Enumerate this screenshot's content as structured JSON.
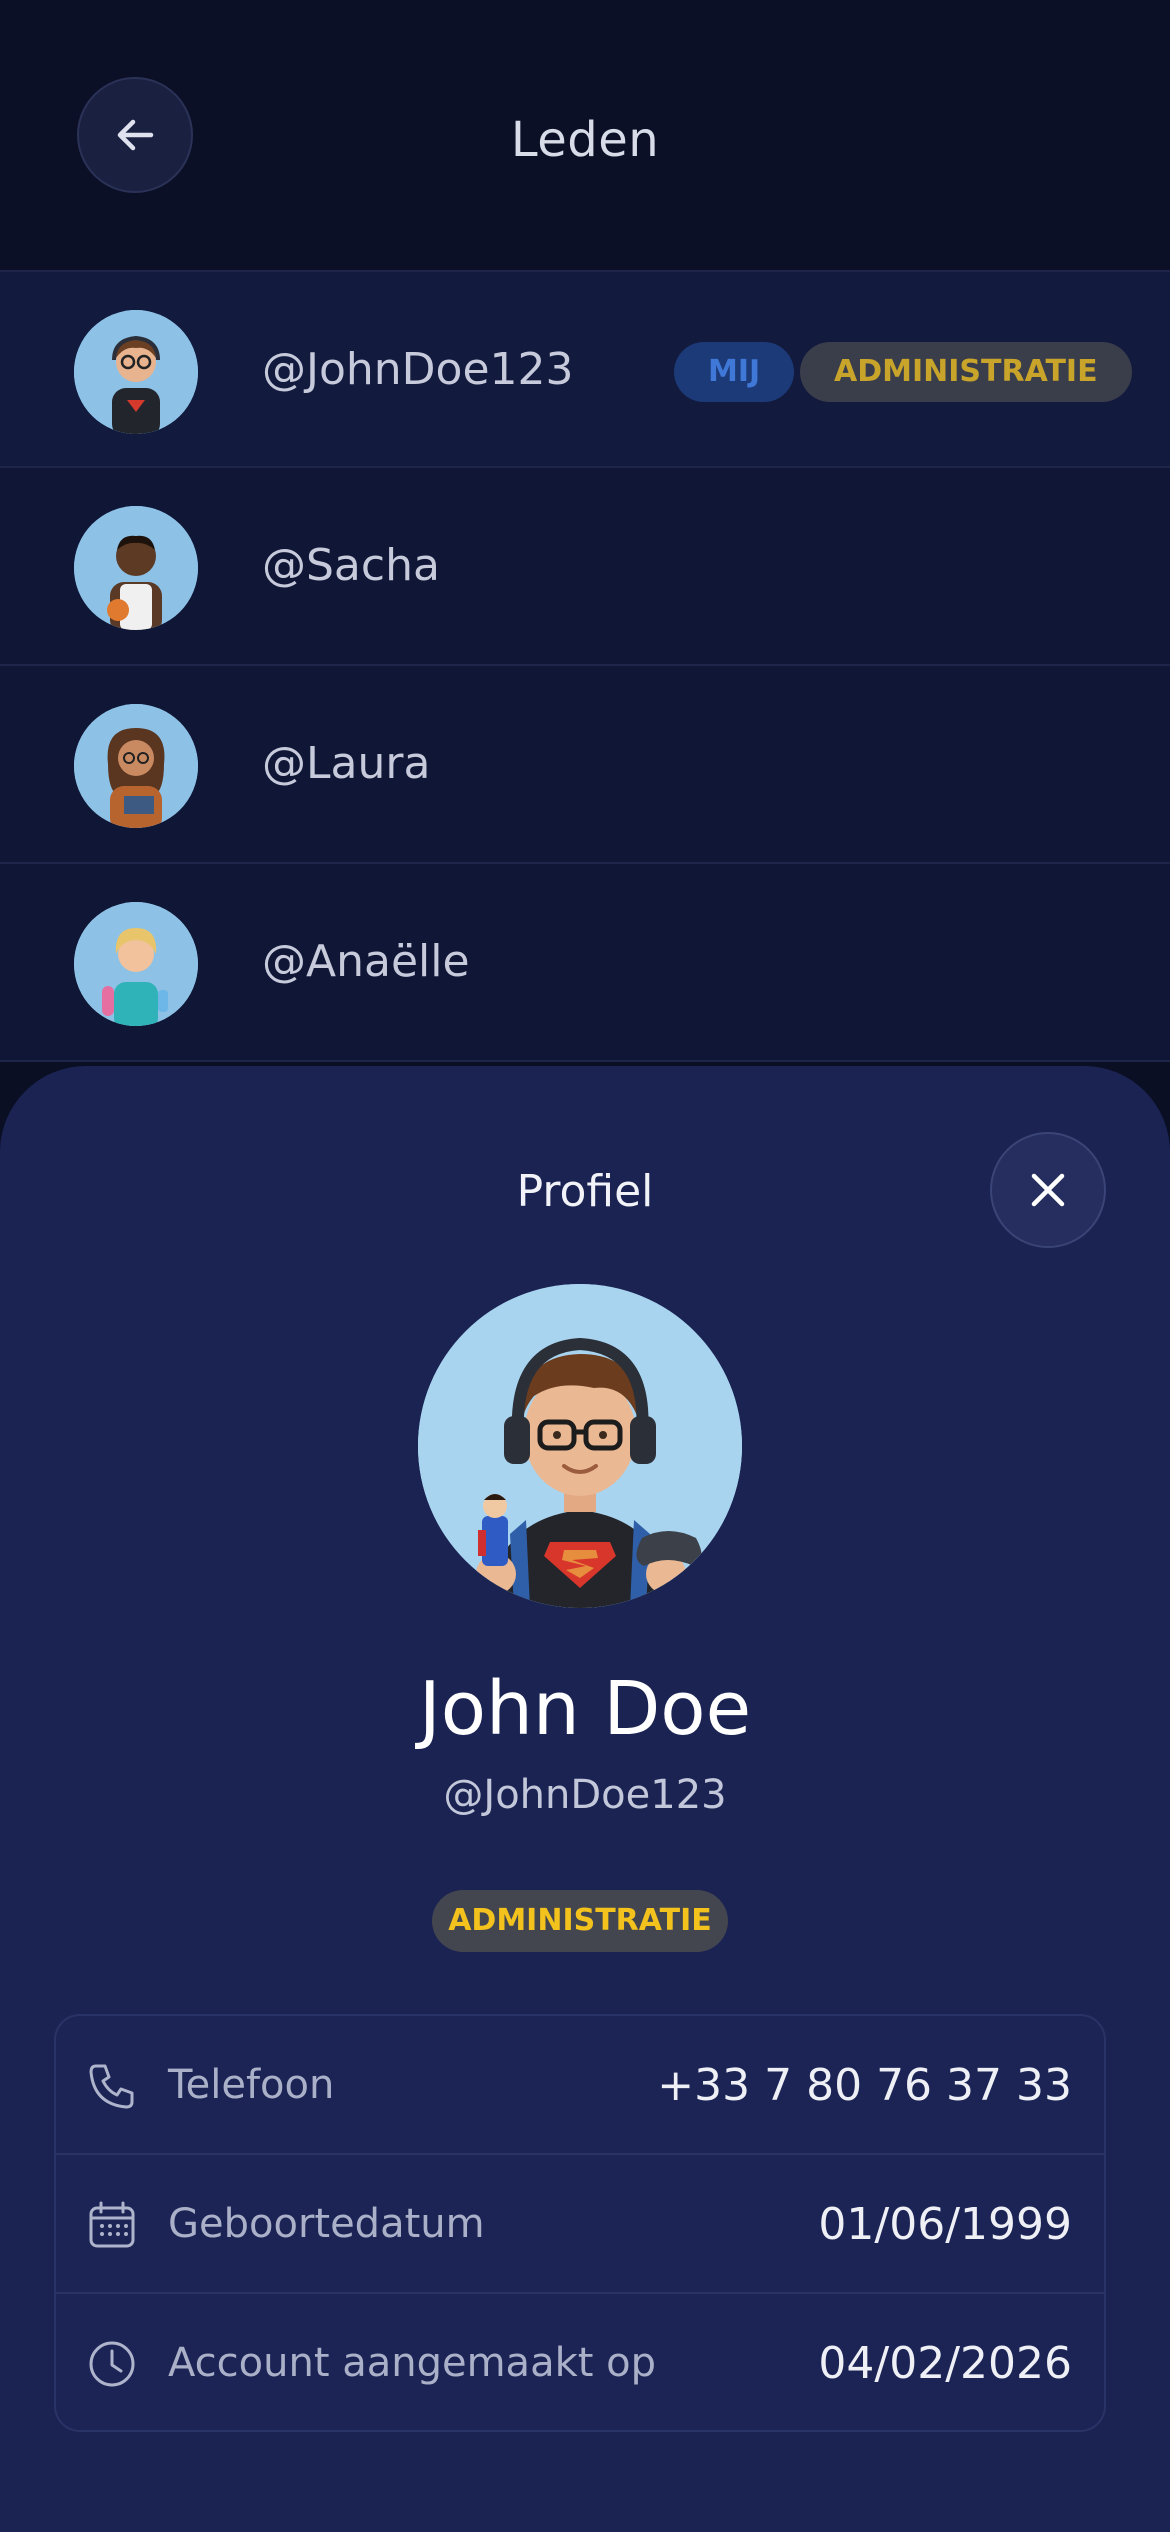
{
  "header": {
    "title": "Leden"
  },
  "members": [
    {
      "handle": "@JohnDoe123",
      "badges": [
        "MIJ",
        "ADMINISTRATIE"
      ]
    },
    {
      "handle": "@Sacha"
    },
    {
      "handle": "@Laura"
    },
    {
      "handle": "@Anaëlle"
    }
  ],
  "profile": {
    "title": "Profiel",
    "full_name": "John Doe",
    "handle": "@JohnDoe123",
    "role": "ADMINISTRATIE",
    "info": [
      {
        "icon": "phone-icon",
        "label": "Telefoon",
        "value": "+33 7 80 76 37 33"
      },
      {
        "icon": "calendar-icon",
        "label": "Geboortedatum",
        "value": "01/06/1999"
      },
      {
        "icon": "clock-icon",
        "label": "Account aangemaakt op",
        "value": "04/02/2026"
      }
    ]
  },
  "colors": {
    "background": "#0a0f24",
    "list_row": "#101635",
    "sheet": "#1a2352",
    "badge_me_bg": "#1d3a78",
    "badge_me_text": "#3f78d6",
    "badge_admin_text": "#f3c21d"
  }
}
